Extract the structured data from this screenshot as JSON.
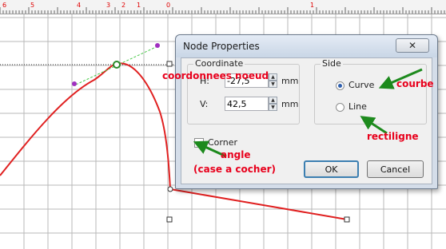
{
  "ruler": {
    "ticks": [
      "6",
      "5",
      "4",
      "3",
      "2",
      "1",
      "0",
      "1"
    ]
  },
  "dialog": {
    "title": "Node Properties",
    "close_symbol": "✕",
    "coordinate": {
      "label": "Coordinate",
      "h_label": "H:",
      "h_value": "-27,5",
      "v_label": "V:",
      "v_value": "42,5",
      "unit": "mm"
    },
    "side": {
      "label": "Side",
      "options": [
        {
          "label": "Curve",
          "checked": true
        },
        {
          "label": "Line",
          "checked": false
        }
      ]
    },
    "corner": {
      "label": "Corner",
      "checked": false
    },
    "ok_label": "OK",
    "cancel_label": "Cancel"
  },
  "annotations": {
    "coords": "coordonnees noeud",
    "curve": "courbe",
    "line": "rectiligne",
    "angle": "angle",
    "checkbox": "(case a cocher)"
  },
  "colors": {
    "annotation": "#e8001c",
    "arrow": "#1d8a1d",
    "curve": "#e02020",
    "grid": "#b8b8b8"
  }
}
